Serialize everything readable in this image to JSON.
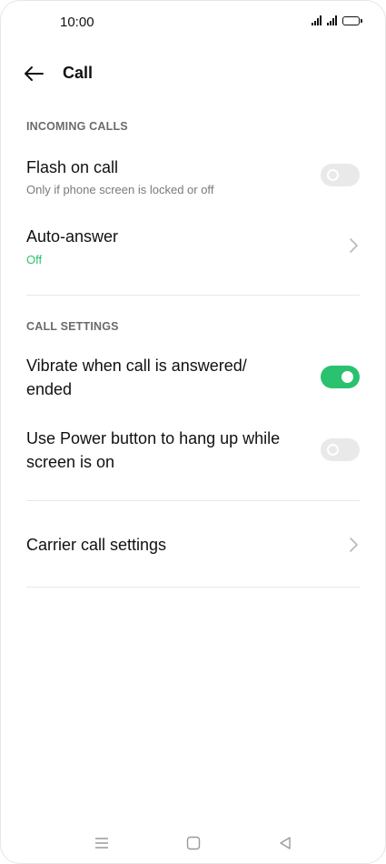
{
  "status_bar": {
    "time": "10:00",
    "icons": [
      "signal-icon",
      "signal-icon",
      "battery-icon"
    ]
  },
  "header": {
    "back_icon": "arrow-left-icon",
    "title": "Call"
  },
  "incoming_calls": {
    "section_label": "INCOMING CALLS",
    "flash_on_call": {
      "title": "Flash on call",
      "subtitle": "Only if phone screen is locked or off",
      "enabled": false
    },
    "auto_answer": {
      "title": "Auto-answer",
      "value": "Off",
      "icon": "chevron-right-icon"
    }
  },
  "call_settings": {
    "section_label": "CALL SETTINGS",
    "vibrate": {
      "title_line1": "Vibrate when call is answered/",
      "title_line2": "ended",
      "enabled": true
    },
    "power_button": {
      "title_line1": "Use Power button to hang up while",
      "title_line2": "screen is on",
      "enabled": false
    }
  },
  "carrier": {
    "title": "Carrier call settings",
    "icon": "chevron-right-icon"
  },
  "nav_bar": {
    "icons": [
      "menu-icon",
      "home-icon",
      "back-triangle-icon"
    ]
  },
  "colors": {
    "accent_green": "#2ac26f",
    "status_green": "#2bbf70",
    "toggle_off": "#e9e9e9",
    "section_gray": "#6b6b6b"
  }
}
